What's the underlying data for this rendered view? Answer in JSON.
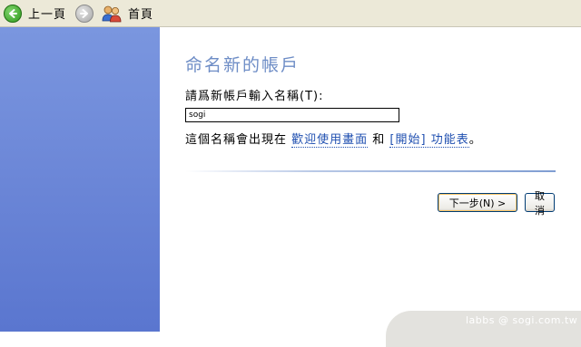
{
  "nav": {
    "back_label": "上一頁",
    "home_label": "首頁"
  },
  "dialog": {
    "title": "命名新的帳戶",
    "prompt": "請爲新帳戶輸入名稱(T):",
    "name_value": "sogi",
    "info_prefix": "這個名稱會出現在 ",
    "welcome_link": "歡迎使用畫面",
    "info_mid": " 和 ",
    "start_link": "[開始] 功能表",
    "info_suffix": "。"
  },
  "buttons": {
    "next_label": "下一步(N) >",
    "cancel_label": "取消"
  },
  "watermark": {
    "text": "labbs  @ sogi.com.tw"
  },
  "colors": {
    "left_pane": "#6d88d8",
    "title": "#6e8dc6",
    "link": "#1f4fb0",
    "toolbar": "#ece9d8"
  },
  "icons": [
    "back-arrow-icon",
    "forward-arrow-icon",
    "users-home-icon"
  ]
}
